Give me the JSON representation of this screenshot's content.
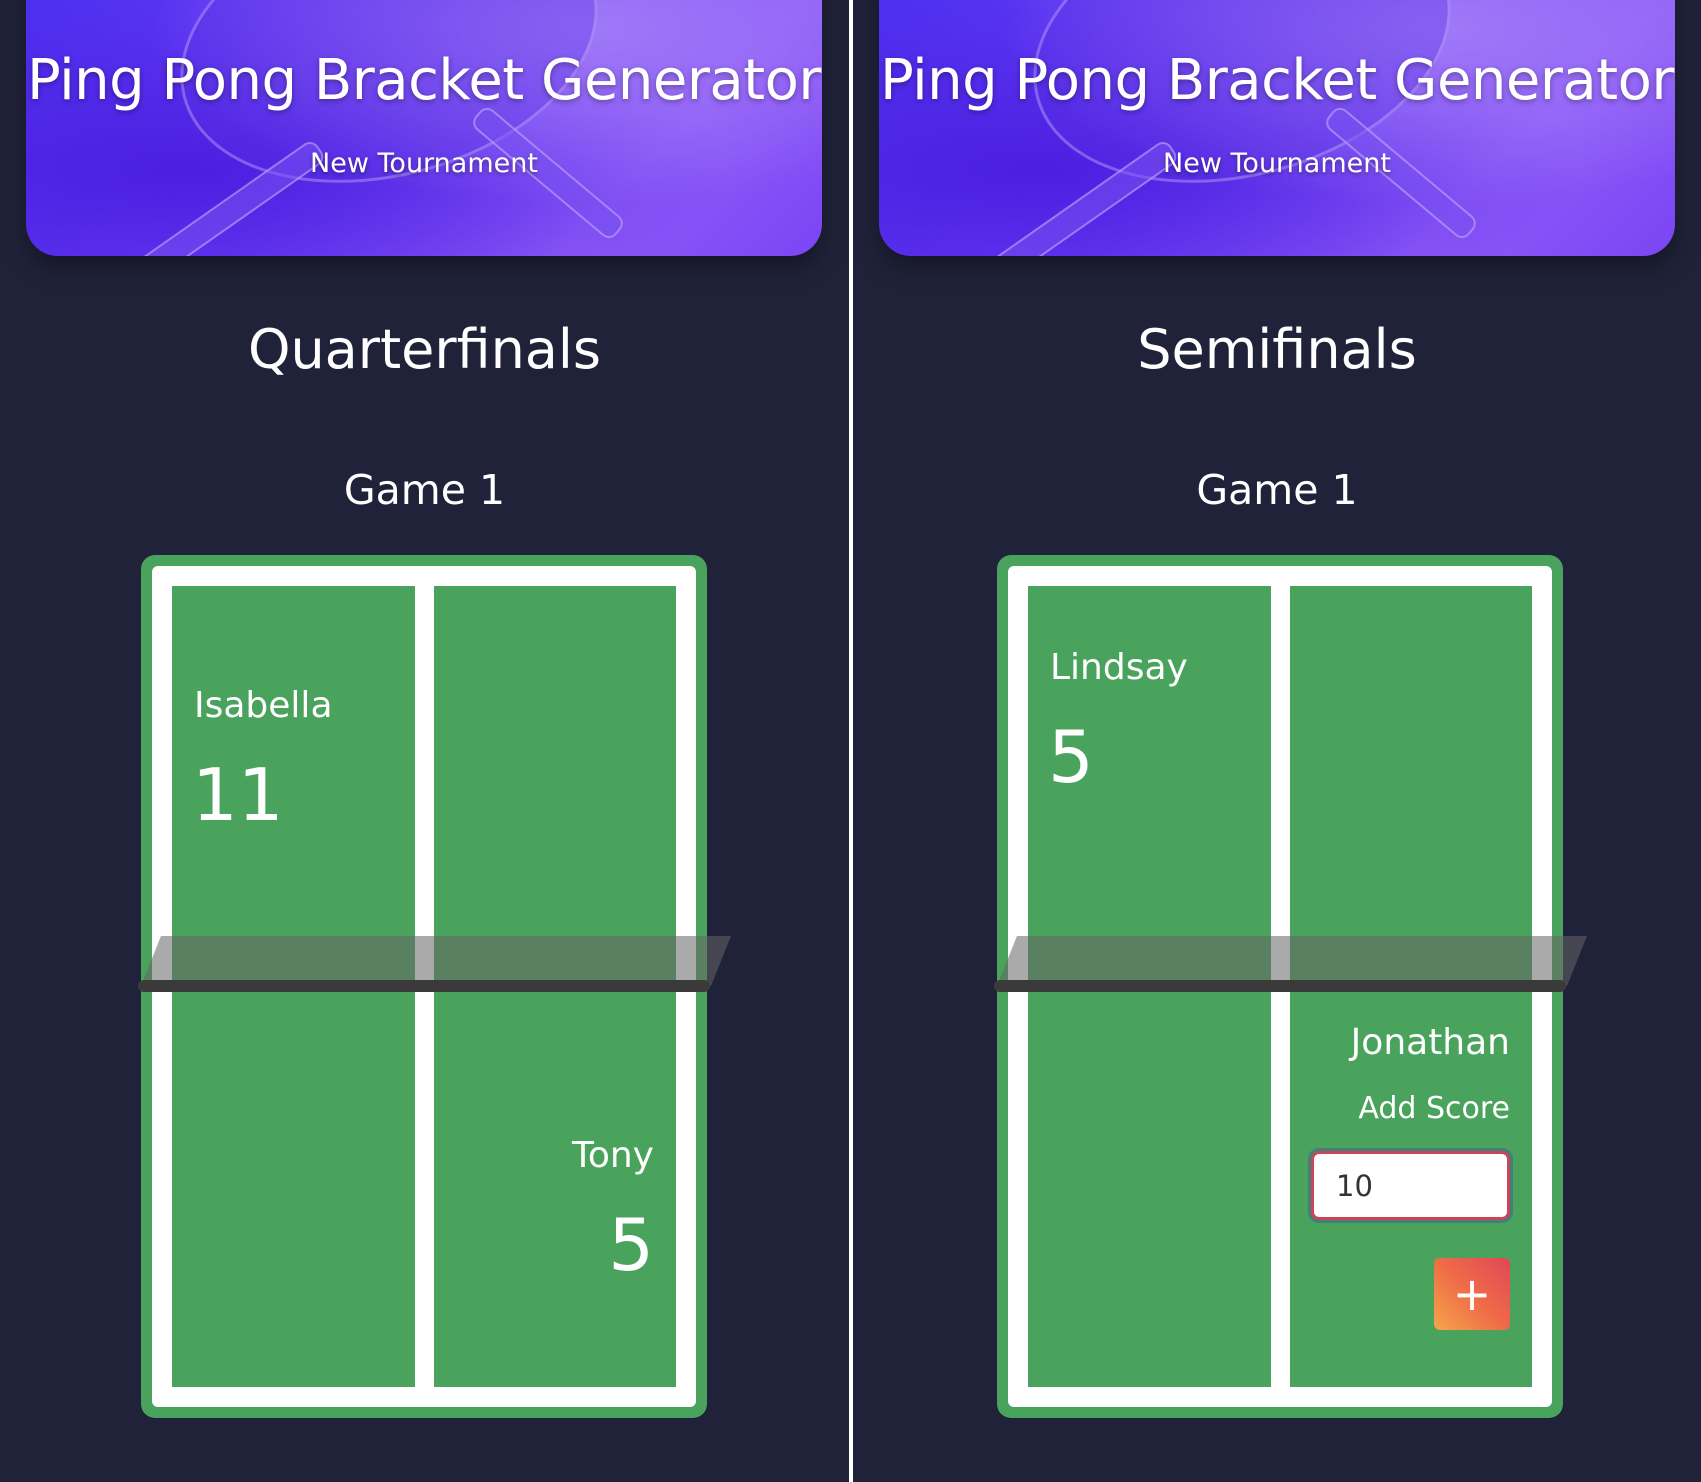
{
  "screens": [
    {
      "header": {
        "title": "Ping Pong Bracket Generator",
        "link": "New Tournament"
      },
      "round": "Quarterfinals",
      "game": "Game 1",
      "player_top": {
        "name": "Isabella",
        "score": "11"
      },
      "player_bottom": {
        "name": "Tony",
        "score": "5"
      }
    },
    {
      "header": {
        "title": "Ping Pong Bracket Generator",
        "link": "New Tournament"
      },
      "round": "Semifinals",
      "game": "Game 1",
      "player_top": {
        "name": "Lindsay",
        "score": "5"
      },
      "player_bottom": {
        "name": "Jonathan",
        "add_score_label": "Add Score",
        "score_input_value": "10",
        "add_button": "+"
      }
    }
  ],
  "colors": {
    "background": "#20223a",
    "table_green": "#4aa35d",
    "accent_gradient_start": "#f5a54a",
    "accent_gradient_end": "#e24657"
  }
}
